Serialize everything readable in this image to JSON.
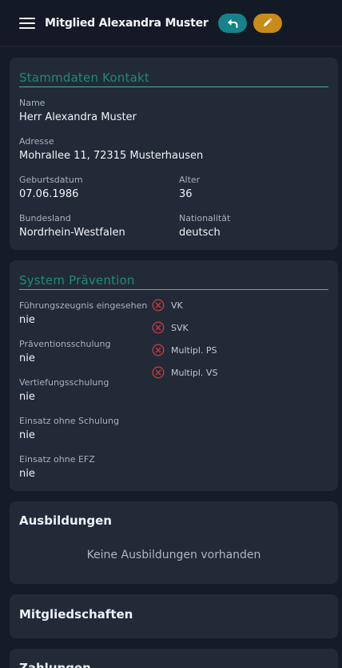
{
  "header": {
    "title": "Mitglied Alexandra Muster",
    "menu_icon": "hamburger-menu-icon",
    "back_icon": "reply-arrow-icon",
    "edit_icon": "pencil-icon",
    "back_color": "#16838a",
    "edit_color": "#c88a18"
  },
  "stammdaten": {
    "title": "Stammdaten  Kontakt",
    "name_label": "Name",
    "name_value": "Herr Alexandra Muster",
    "address_label": "Adresse",
    "address_value": "Mohrallee 11, 72315 Musterhausen",
    "birthdate_label": "Geburtsdatum",
    "birthdate_value": "07.06.1986",
    "age_label": "Alter",
    "age_value": "36",
    "state_label": "Bundesland",
    "state_value": "Nordrhein-Westfalen",
    "nationality_label": "Nationalität",
    "nationality_value": "deutsch"
  },
  "praevention": {
    "title": "System  Prävention",
    "fields": [
      {
        "label": "Führungszeugnis eingesehen",
        "value": "nie"
      },
      {
        "label": "Präventionsschulung",
        "value": "nie"
      },
      {
        "label": "Vertiefungsschulung",
        "value": "nie"
      },
      {
        "label": "Einsatz ohne Schulung",
        "value": "nie"
      },
      {
        "label": "Einsatz ohne EFZ",
        "value": "nie"
      }
    ],
    "flags": [
      {
        "label": "VK",
        "icon": "x-circle-icon"
      },
      {
        "label": "SVK",
        "icon": "x-circle-icon"
      },
      {
        "label": "Multipl. PS",
        "icon": "x-circle-icon"
      },
      {
        "label": "Multipl. VS",
        "icon": "x-circle-icon"
      }
    ],
    "flag_color": "#c23b3b"
  },
  "ausbildungen": {
    "title": "Ausbildungen",
    "empty_text": "Keine Ausbildungen vorhanden"
  },
  "mitgliedschaften": {
    "title": "Mitgliedschaften"
  },
  "zahlungen": {
    "title": "Zahlungen"
  },
  "colors": {
    "background": "#161c27",
    "card": "#222a38",
    "section_title": "#1e8a78",
    "section_rule": "#3fb6a4"
  }
}
